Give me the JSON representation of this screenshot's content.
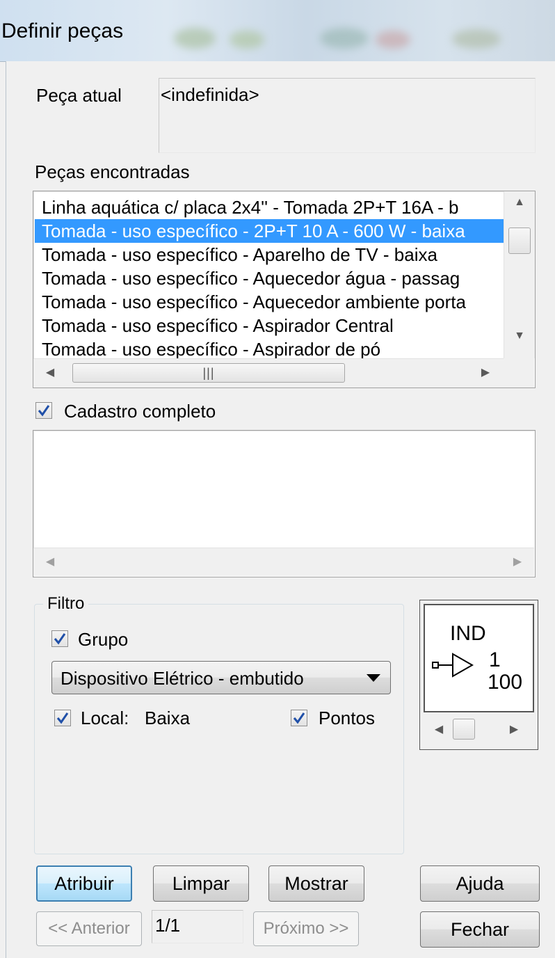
{
  "window": {
    "title": "Definir peças"
  },
  "current_piece": {
    "label": "Peça atual",
    "value": "<indefinida>"
  },
  "found_pieces": {
    "label": "Peças encontradas",
    "items": [
      "Linha aquática c/ placa 2x4'' - Tomada 2P+T 16A - b",
      "Tomada - uso específico - 2P+T 10 A - 600 W - baixa",
      "Tomada - uso específico - Aparelho de TV - baixa",
      "Tomada - uso específico - Aquecedor água - passag",
      "Tomada - uso específico - Aquecedor ambiente porta",
      "Tomada - uso específico - Aspirador Central",
      "Tomada - uso específico - Aspirador de pó"
    ],
    "selected_index": 1
  },
  "full_registry": {
    "label": "Cadastro completo",
    "checked": true
  },
  "filter": {
    "label": "Filtro",
    "group": {
      "label": "Grupo",
      "checked": true
    },
    "group_value": "Dispositivo Elétrico - embutido",
    "local": {
      "label": "Local:",
      "value": "Baixa",
      "checked": true
    },
    "points": {
      "label": "Pontos",
      "checked": true
    }
  },
  "preview": {
    "line1": "IND",
    "line2": "1",
    "line3": "100"
  },
  "buttons": {
    "assign": "Atribuir",
    "clear": "Limpar",
    "show": "Mostrar",
    "help": "Ajuda",
    "previous": "<< Anterior",
    "next": "Próximo >>",
    "close": "Fechar"
  },
  "pager": {
    "value": "1/1"
  },
  "icons": {
    "scroll_grip": "|||"
  },
  "colors": {
    "selection": "#3399ff",
    "check": "#1f4fa8"
  }
}
